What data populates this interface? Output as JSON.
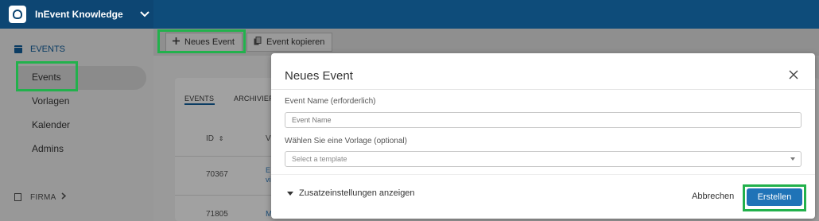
{
  "app": {
    "title": "InEvent Knowledge"
  },
  "sidebar": {
    "section_label": "EVENTS",
    "items": [
      {
        "label": "Events"
      },
      {
        "label": "Vorlagen"
      },
      {
        "label": "Kalender"
      },
      {
        "label": "Admins"
      }
    ],
    "firma_label": "FIRMA"
  },
  "toolbar": {
    "new_event_label": "Neues Event",
    "copy_event_label": "Event kopieren"
  },
  "content": {
    "tabs": [
      "EVENTS",
      "ARCHIVIER"
    ],
    "id_header": "ID",
    "rows": [
      {
        "id": "70367",
        "snippet_a": "E",
        "snippet_b": "vi"
      },
      {
        "id": "71805",
        "snippet_a": "M",
        "snippet_b": ""
      }
    ]
  },
  "modal": {
    "title": "Neues Event",
    "name_label": "Event Name (erforderlich)",
    "name_placeholder": "Event Name",
    "template_label": "Wählen Sie eine Vorlage (optional)",
    "template_value": "Select a template",
    "extra_settings_label": "Zusatzeinstellungen anzeigen",
    "cancel_label": "Abbrechen",
    "create_label": "Erstellen"
  },
  "colors": {
    "topbar": "#0e4c7a",
    "highlight": "#22b14c",
    "primary_button": "#1f73b7",
    "overlay": "#9a9a9a"
  }
}
